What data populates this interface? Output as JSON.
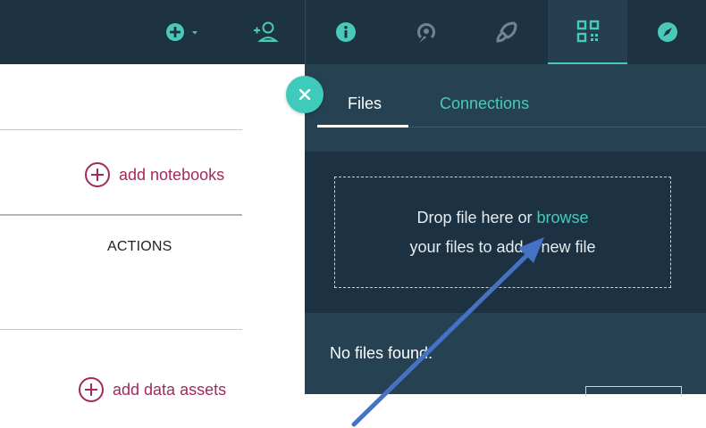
{
  "topbar": {
    "icons": [
      {
        "name": "create-plus-icon",
        "has_dropdown": true
      },
      {
        "name": "add-collaborator-icon"
      },
      {
        "name": "info-icon"
      },
      {
        "name": "history-icon"
      },
      {
        "name": "rocket-icon"
      },
      {
        "name": "data-assets-icon",
        "active": true
      },
      {
        "name": "compass-icon"
      }
    ]
  },
  "left_page": {
    "add_notebooks_label": "add notebooks",
    "actions_column_header": "ACTIONS",
    "add_data_assets_label": "add data assets"
  },
  "panel": {
    "tabs": [
      {
        "label": "Files",
        "active": true
      },
      {
        "label": "Connections",
        "active": false
      }
    ],
    "dropzone": {
      "line1_prefix": "Drop file here or ",
      "browse_link": "browse",
      "line2": "your files to add a new file"
    },
    "empty_state": "No files found."
  },
  "colors": {
    "topbar_bg": "#1e3342",
    "panel_bg": "#254152",
    "dropzone_bg": "#1c3242",
    "accent_teal": "#49c9b9",
    "link_magenta": "#a3295d",
    "annotation_arrow": "#4472c4"
  }
}
